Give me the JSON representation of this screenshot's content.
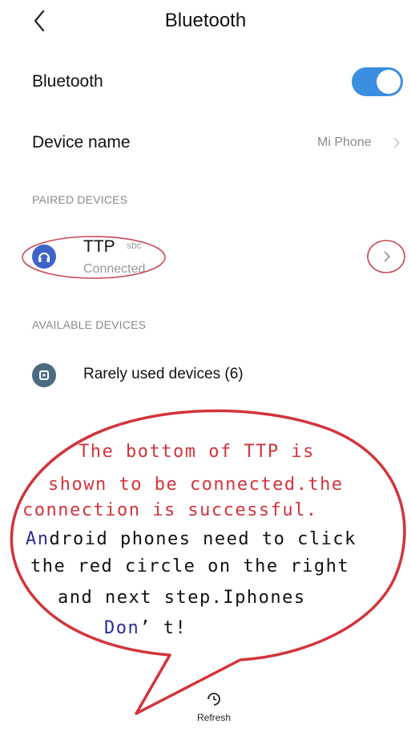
{
  "header": {
    "title": "Bluetooth"
  },
  "bluetooth_row": {
    "label": "Bluetooth",
    "enabled": true
  },
  "device_name_row": {
    "label": "Device name",
    "value": "Mi Phone"
  },
  "paired_section": {
    "title": "PAIRED DEVICES"
  },
  "paired_devices": [
    {
      "name": "TTP",
      "codec": "sbc",
      "status": "Connected"
    }
  ],
  "available_section": {
    "title": "AVAILABLE DEVICES"
  },
  "available_devices": [
    {
      "label": "Rarely used devices (6)"
    }
  ],
  "annotation": {
    "line1": "The bottom of TTP is",
    "line2": "shown to be connected.the",
    "line3": "connection is successful.",
    "line4a": "An",
    "line4b": "droid phones need to click",
    "line5": "the red circle on the right",
    "line6": "and next step.Iphones",
    "line7a": "Don",
    "line7b": "’ t!"
  },
  "footer": {
    "refresh_label": "Refresh"
  },
  "colors": {
    "accent": "#3a8fe0",
    "annotation_red": "#d2343b"
  }
}
